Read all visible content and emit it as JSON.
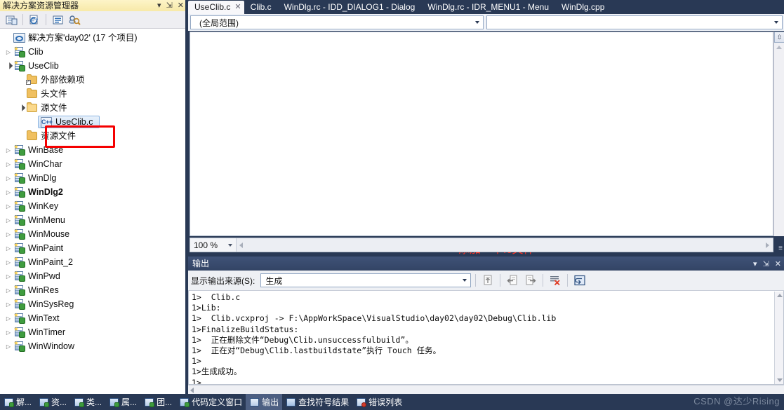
{
  "solution_explorer": {
    "title": "解决方案资源管理器",
    "header_buttons": [
      {
        "name": "dropdown",
        "glyph": "▾"
      },
      {
        "name": "pin",
        "glyph": "⇲"
      },
      {
        "name": "close",
        "glyph": "✕"
      }
    ],
    "toolbar_icons": [
      "home-icon",
      "refresh-icon",
      "properties-icon",
      "show-all-files-icon"
    ],
    "tree": [
      {
        "indent": 0,
        "twisty": "empty",
        "icon": "solution-icon",
        "label": "解决方案'day02' (17 个项目)",
        "bold": false
      },
      {
        "indent": 0,
        "twisty": "collapsed",
        "icon": "project-icon",
        "label": "Clib",
        "bold": false
      },
      {
        "indent": 0,
        "twisty": "expanded",
        "icon": "project-icon",
        "label": "UseClib",
        "bold": false
      },
      {
        "indent": 1,
        "twisty": "empty",
        "icon": "folder-ext-icon",
        "label": "外部依赖项",
        "bold": false
      },
      {
        "indent": 1,
        "twisty": "empty",
        "icon": "folder-icon",
        "label": "头文件",
        "bold": false
      },
      {
        "indent": 1,
        "twisty": "expanded",
        "icon": "folder-open-icon",
        "label": "源文件",
        "bold": false
      },
      {
        "indent": 2,
        "twisty": "empty",
        "icon": "cpp-file-icon",
        "label": "UseClib.c",
        "bold": false,
        "selected": true
      },
      {
        "indent": 1,
        "twisty": "empty",
        "icon": "folder-icon",
        "label": "资源文件",
        "bold": false
      },
      {
        "indent": 0,
        "twisty": "collapsed",
        "icon": "project-icon",
        "label": "WinBase",
        "bold": false
      },
      {
        "indent": 0,
        "twisty": "collapsed",
        "icon": "project-icon",
        "label": "WinChar",
        "bold": false
      },
      {
        "indent": 0,
        "twisty": "collapsed",
        "icon": "project-icon",
        "label": "WinDlg",
        "bold": false
      },
      {
        "indent": 0,
        "twisty": "collapsed",
        "icon": "project-icon",
        "label": "WinDlg2",
        "bold": true
      },
      {
        "indent": 0,
        "twisty": "collapsed",
        "icon": "project-icon",
        "label": "WinKey",
        "bold": false
      },
      {
        "indent": 0,
        "twisty": "collapsed",
        "icon": "project-icon",
        "label": "WinMenu",
        "bold": false
      },
      {
        "indent": 0,
        "twisty": "collapsed",
        "icon": "project-icon",
        "label": "WinMouse",
        "bold": false
      },
      {
        "indent": 0,
        "twisty": "collapsed",
        "icon": "project-icon",
        "label": "WinPaint",
        "bold": false
      },
      {
        "indent": 0,
        "twisty": "collapsed",
        "icon": "project-icon",
        "label": "WinPaint_2",
        "bold": false
      },
      {
        "indent": 0,
        "twisty": "collapsed",
        "icon": "project-icon",
        "label": "WinPwd",
        "bold": false
      },
      {
        "indent": 0,
        "twisty": "collapsed",
        "icon": "project-icon",
        "label": "WinRes",
        "bold": false
      },
      {
        "indent": 0,
        "twisty": "collapsed",
        "icon": "project-icon",
        "label": "WinSysReg",
        "bold": false
      },
      {
        "indent": 0,
        "twisty": "collapsed",
        "icon": "project-icon",
        "label": "WinText",
        "bold": false
      },
      {
        "indent": 0,
        "twisty": "collapsed",
        "icon": "project-icon",
        "label": "WinTimer",
        "bold": false
      },
      {
        "indent": 0,
        "twisty": "collapsed",
        "icon": "project-icon",
        "label": "WinWindow",
        "bold": false
      }
    ]
  },
  "editor": {
    "tabs": [
      {
        "label": "UseClib.c",
        "active": true,
        "closable": true
      },
      {
        "label": "Clib.c",
        "active": false,
        "closable": false
      },
      {
        "label": "WinDlg.rc - IDD_DIALOG1 - Dialog",
        "active": false,
        "closable": false
      },
      {
        "label": "WinDlg.rc - IDR_MENU1 - Menu",
        "active": false,
        "closable": false
      },
      {
        "label": "WinDlg.cpp",
        "active": false,
        "closable": false
      }
    ],
    "tab_overflow_glyph": "≡",
    "scope_combo_value": "(全局范围)",
    "member_combo_value": "",
    "annotation": "添加一个.c文件",
    "zoom_level": "100 %"
  },
  "output": {
    "title": "输出",
    "header_buttons": [
      {
        "name": "dropdown",
        "glyph": "▾"
      },
      {
        "name": "pin",
        "glyph": "⇲"
      },
      {
        "name": "close",
        "glyph": "✕"
      }
    ],
    "source_label": "显示输出来源(S):",
    "source_value": "生成",
    "toolbar_icons": [
      "goto-message-icon",
      "prev-message-icon",
      "next-message-icon",
      "clear-all-icon",
      "word-wrap-icon"
    ],
    "lines": [
      "1>  Clib.c",
      "1>Lib:",
      "1>  Clib.vcxproj -> F:\\AppWorkSpace\\VisualStudio\\day02\\day02\\Debug\\Clib.lib",
      "1>FinalizeBuildStatus:",
      "1>  正在删除文件“Debug\\Clib.unsuccessfulbuild”。",
      "1>  正在对“Debug\\Clib.lastbuildstate”执行 Touch 任务。",
      "1>",
      "1>生成成功。",
      "1>"
    ]
  },
  "bottom_tabs": [
    {
      "label": "解...",
      "icon": "solution-explorer-icon",
      "active": false
    },
    {
      "label": "资...",
      "icon": "resource-view-icon",
      "active": false
    },
    {
      "label": "类...",
      "icon": "class-view-icon",
      "active": false
    },
    {
      "label": "属...",
      "icon": "properties-icon",
      "active": false
    },
    {
      "label": "团...",
      "icon": "team-explorer-icon",
      "active": false
    },
    {
      "label": "代码定义窗口",
      "icon": "code-definition-icon",
      "active": false
    },
    {
      "label": "输出",
      "icon": "output-icon",
      "active": true
    },
    {
      "label": "查找符号结果",
      "icon": "find-symbol-icon",
      "active": false
    },
    {
      "label": "错误列表",
      "icon": "error-list-icon",
      "active": false
    }
  ],
  "watermark": "CSDN @达少Rising"
}
